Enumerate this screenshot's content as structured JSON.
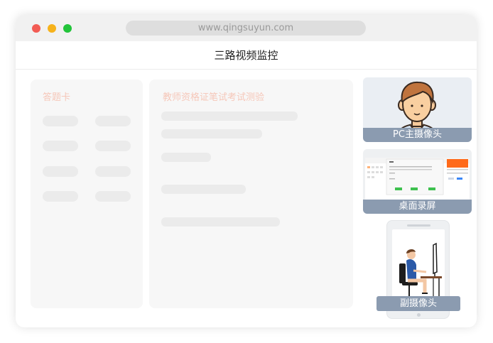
{
  "browser": {
    "url": "www.qingsuyun.com"
  },
  "app": {
    "title": "三路视频监控"
  },
  "answer_card": {
    "title": "答题卡"
  },
  "exam": {
    "title": "教师资格证笔试考试测验"
  },
  "cameras": {
    "pc_label": "PC主摄像头",
    "desktop_label": "桌面录屏",
    "secondary_label": "副摄像头"
  },
  "colors": {
    "accent_orange": "#f6c7b9",
    "label_bg": "#8b9bb0",
    "traffic_red": "#f25c54",
    "traffic_yellow": "#f6b21b",
    "traffic_green": "#22c43a"
  },
  "icons": [
    "close-dot-icon",
    "minimize-dot-icon",
    "maximize-dot-icon",
    "person-avatar-icon",
    "desk-worker-icon"
  ]
}
